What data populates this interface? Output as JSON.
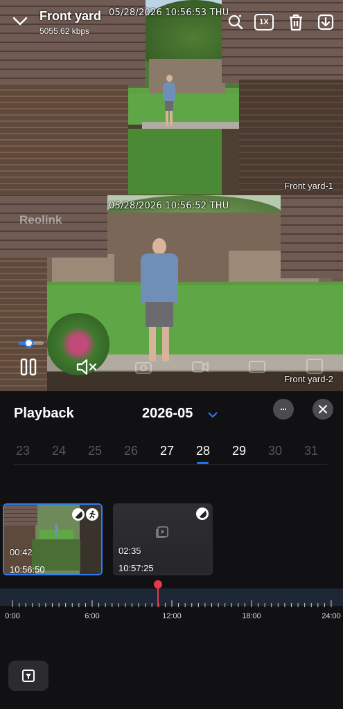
{
  "header": {
    "camera_name": "Front yard",
    "bitrate": "5055.62 kbps",
    "speed_label": "1X"
  },
  "video": {
    "cam1": {
      "timestamp": "05/28/2026 10:56:53 THU",
      "label": "Front yard-1"
    },
    "cam2": {
      "timestamp": "05/28/2026 10:56:52 THU",
      "label": "Front yard-2",
      "watermark": "Reolink"
    },
    "volume_level": 0.4
  },
  "playback": {
    "title": "Playback",
    "month": "2026-05",
    "more_label": "···",
    "days": [
      {
        "label": "23",
        "has_recording": false
      },
      {
        "label": "24",
        "has_recording": false
      },
      {
        "label": "25",
        "has_recording": false
      },
      {
        "label": "26",
        "has_recording": false
      },
      {
        "label": "27",
        "has_recording": true
      },
      {
        "label": "28",
        "has_recording": true,
        "selected": true
      },
      {
        "label": "29",
        "has_recording": true
      },
      {
        "label": "30",
        "has_recording": false
      },
      {
        "label": "31",
        "has_recording": false
      }
    ],
    "clips": [
      {
        "duration": "00:42",
        "start": "10:56:50",
        "selected": true,
        "badges": [
          "day-night-icon",
          "person-motion-icon"
        ]
      },
      {
        "duration": "02:35",
        "start": "10:57:25",
        "selected": false,
        "badges": [
          "day-night-icon"
        ]
      }
    ],
    "timeline": {
      "labels": [
        "0:00",
        "6:00",
        "12:00",
        "18:00",
        "24:00"
      ],
      "playhead_hour": 10.95
    }
  },
  "colors": {
    "accent": "#2f7cf2",
    "playhead": "#e8374b",
    "background": "#111114"
  }
}
